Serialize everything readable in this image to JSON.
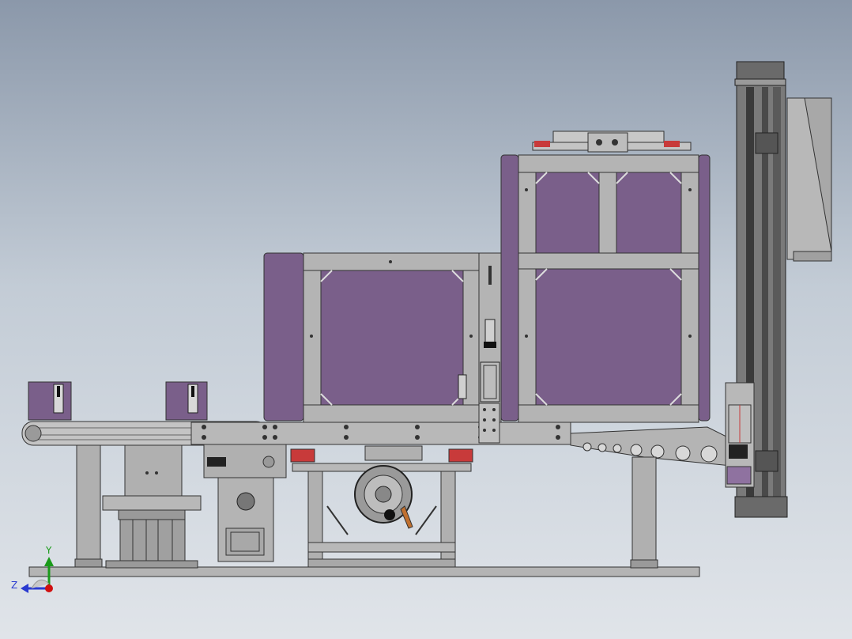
{
  "viewport": {
    "triad": {
      "y_label": "Y",
      "z_label": "Z"
    }
  },
  "colors": {
    "background_top": "#8b98aa",
    "background_bottom": "#e0e4e9",
    "frame_gray": "#b0b0b0",
    "frame_dark": "#5a5a5a",
    "panel_purple": "#7a5f8a",
    "panel_purple_light": "#8f72a0",
    "sensor_red": "#c83a3a",
    "accent_orange": "#c07030",
    "axis_green": "#1a9a1a",
    "axis_blue": "#2a3ad0",
    "axis_red": "#d01010"
  }
}
